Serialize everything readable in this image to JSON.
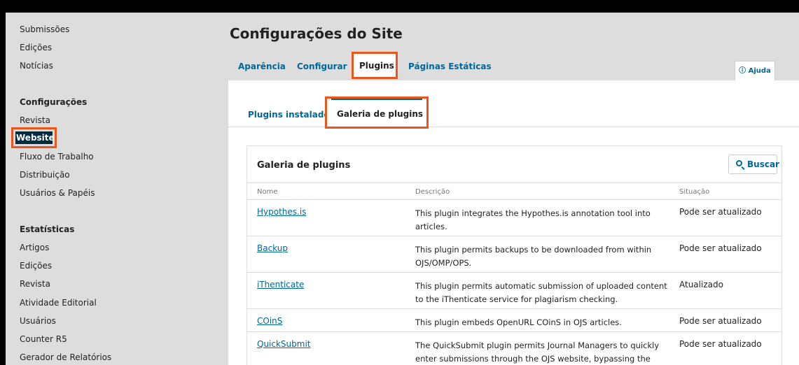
{
  "sidebar": {
    "items": [
      {
        "label": "Submissões"
      },
      {
        "label": "Edições"
      },
      {
        "label": "Notícias"
      }
    ],
    "settings_heading": "Configurações",
    "settings_items": [
      {
        "label": "Revista"
      },
      {
        "label": "Website"
      },
      {
        "label": "Fluxo de Trabalho"
      },
      {
        "label": "Distribuição"
      },
      {
        "label": "Usuários & Papéis"
      }
    ],
    "stats_heading": "Estatísticas",
    "stats_items": [
      {
        "label": "Artigos"
      },
      {
        "label": "Edições"
      },
      {
        "label": "Revista"
      },
      {
        "label": "Atividade Editorial"
      },
      {
        "label": "Usuários"
      },
      {
        "label": "Counter R5"
      },
      {
        "label": "Gerador de Relatórios"
      }
    ]
  },
  "main": {
    "title": "Configurações do Site",
    "tabs": [
      {
        "label": "Aparência"
      },
      {
        "label": "Configurar"
      },
      {
        "label": "Plugins"
      },
      {
        "label": "Páginas Estáticas"
      }
    ],
    "help": {
      "icon": "info-circle-icon",
      "label": "Ajuda"
    },
    "sub_tabs": [
      {
        "label": "Plugins instalados"
      },
      {
        "label": "Galeria de plugins"
      }
    ],
    "grid": {
      "title": "Galeria de plugins",
      "search_label": "Buscar",
      "columns": [
        "Nome",
        "Descrição",
        "Situação"
      ],
      "rows": [
        {
          "name": "Hypothes.is",
          "description": "This plugin integrates the Hypothes.is annotation tool into articles.",
          "status": "Pode ser atualizado"
        },
        {
          "name": "Backup",
          "description": "This plugin permits backups to be downloaded from within OJS/OMP/OPS.",
          "status": "Pode ser atualizado"
        },
        {
          "name": "iThenticate",
          "description": "This plugin permits automatic submission of uploaded content to the iThenticate service for plagiarism checking.",
          "status": "Atualizado"
        },
        {
          "name": "COinS",
          "description": "This plugin embeds OpenURL COinS in OJS articles.",
          "status": "Pode ser atualizado"
        },
        {
          "name": "QuickSubmit",
          "description": "The QuickSubmit plugin permits Journal Managers to quickly enter submissions through the OJS website, bypassing the editorial workflow.",
          "status": "Pode ser atualizado"
        }
      ]
    }
  },
  "colors": {
    "link": "#006798",
    "highlight": "#e8581c",
    "active_sidebar_bg": "#002c40"
  }
}
